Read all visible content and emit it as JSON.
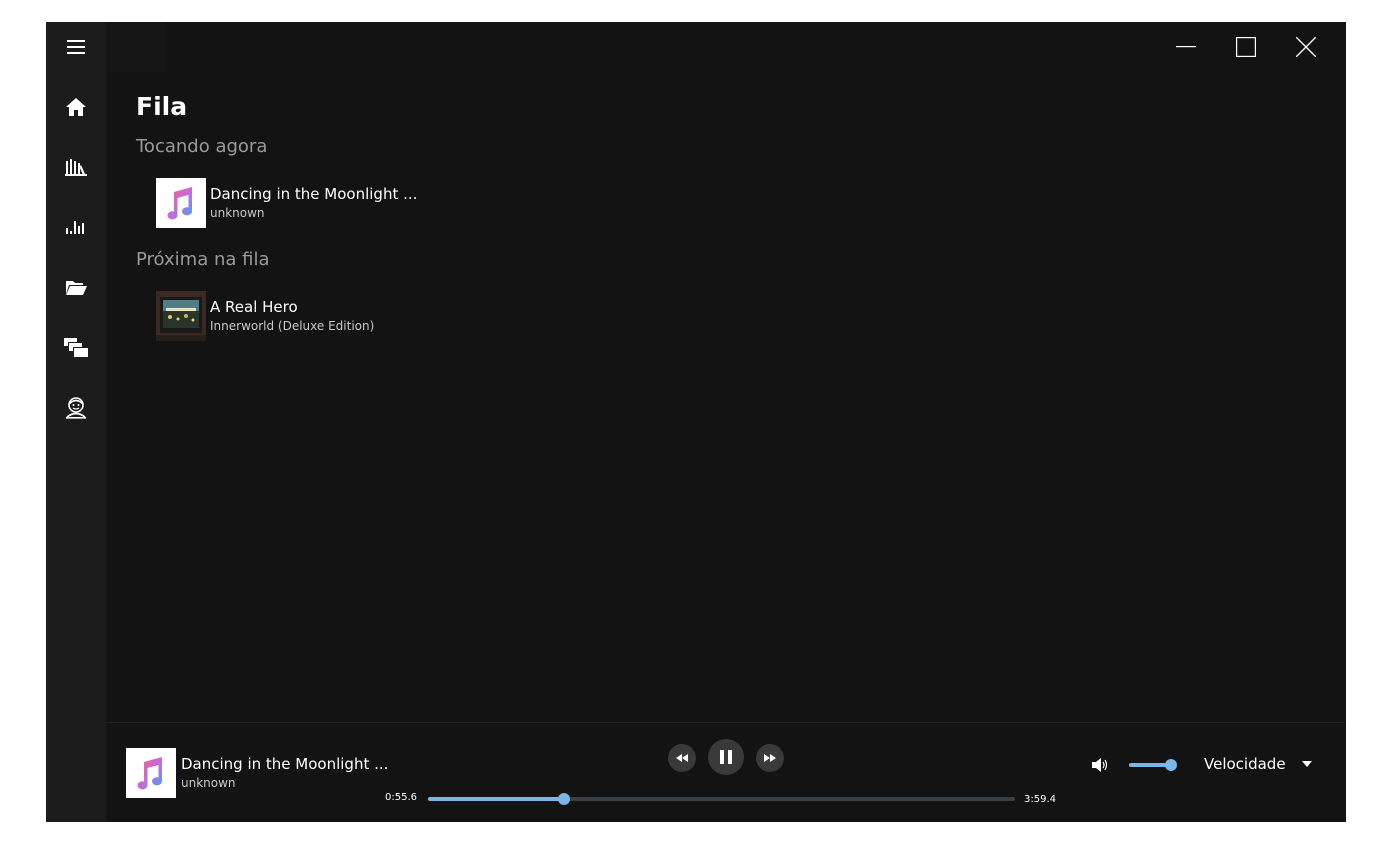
{
  "page": {
    "title": "Fila"
  },
  "sections": {
    "now_playing_label": "Tocando agora",
    "up_next_label": "Próxima na fila"
  },
  "queue": {
    "now_playing": {
      "title": "Dancing in the Moonlight ...",
      "subtitle": "unknown",
      "art": "music-note-icon"
    },
    "up_next": [
      {
        "title": "A Real Hero",
        "subtitle": "Innerworld (Deluxe Edition)",
        "art": "album-cover"
      }
    ]
  },
  "sidebar": {
    "items": [
      {
        "name": "menu",
        "icon": "hamburger-icon"
      },
      {
        "name": "home",
        "icon": "home-icon"
      },
      {
        "name": "library",
        "icon": "library-icon"
      },
      {
        "name": "visualizer",
        "icon": "equalizer-icon"
      },
      {
        "name": "folders",
        "icon": "folder-icon"
      },
      {
        "name": "queue",
        "icon": "stack-icon"
      },
      {
        "name": "about",
        "icon": "avatar-icon"
      }
    ]
  },
  "window_controls": [
    "minimize",
    "maximize",
    "close"
  ],
  "player": {
    "title": "Dancing in the Moonlight ...",
    "artist": "unknown",
    "time_current": "0:55.6",
    "time_total": "3:59.4",
    "progress": 0.2325,
    "volume": 1.0,
    "speed_label": "Velocidade",
    "state": "playing"
  },
  "colors": {
    "accent": "#7ab6e8",
    "background": "#131313",
    "sidebar": "#1c1c1c",
    "control": "#3a3a3a"
  }
}
